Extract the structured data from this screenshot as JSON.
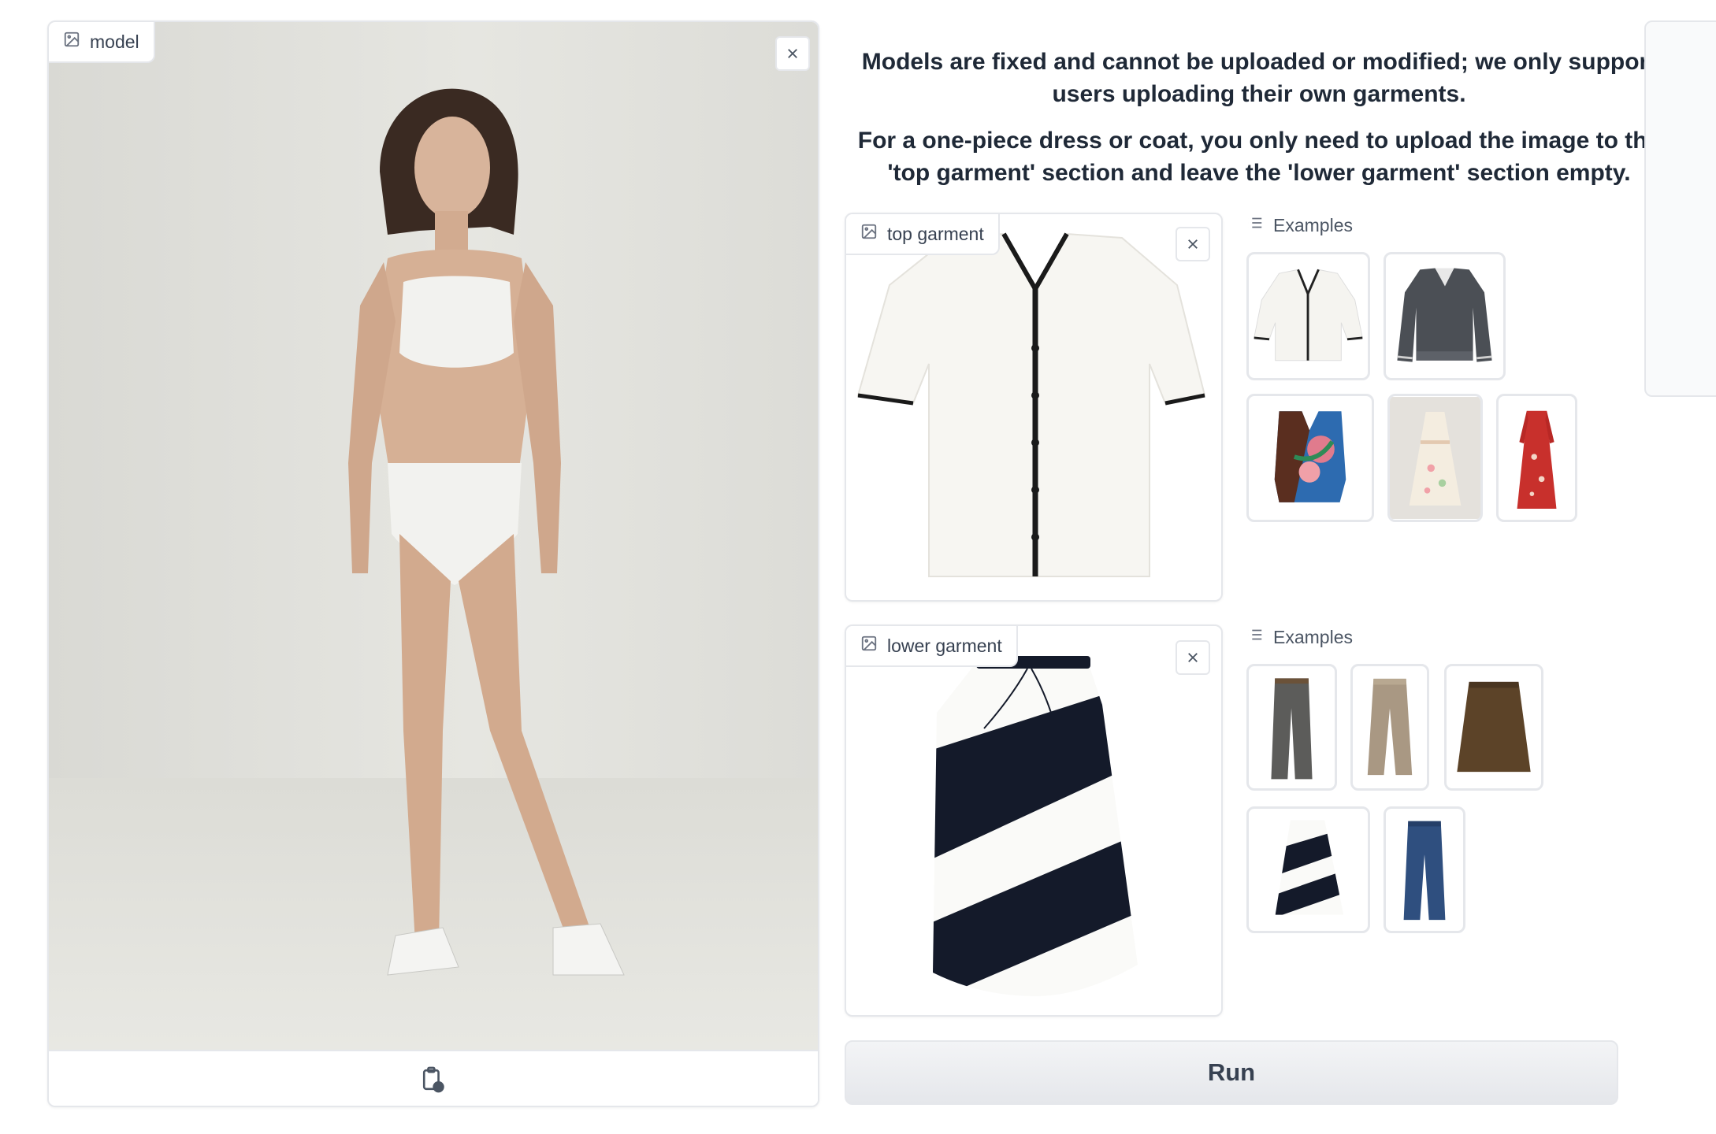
{
  "intro": {
    "line1": "Models are fixed and cannot be uploaded or modified; we only support users uploading their own garments.",
    "line2": "For a one-piece dress or coat, you only need to upload the image to the 'top garment' section and leave the 'lower garment' section empty."
  },
  "model": {
    "label": "model"
  },
  "top": {
    "label": "top garment"
  },
  "lower": {
    "label": "lower garment"
  },
  "top_examples": {
    "label": "Examples"
  },
  "lower_examples": {
    "label": "Examples"
  },
  "run": {
    "label": "Run"
  },
  "icons": [
    "image-icon",
    "close-icon",
    "list-icon",
    "clipboard-paste-icon"
  ],
  "colors": {
    "background": "#ffffff",
    "border": "#e5e7eb",
    "run_button": "#e5e7eb"
  }
}
